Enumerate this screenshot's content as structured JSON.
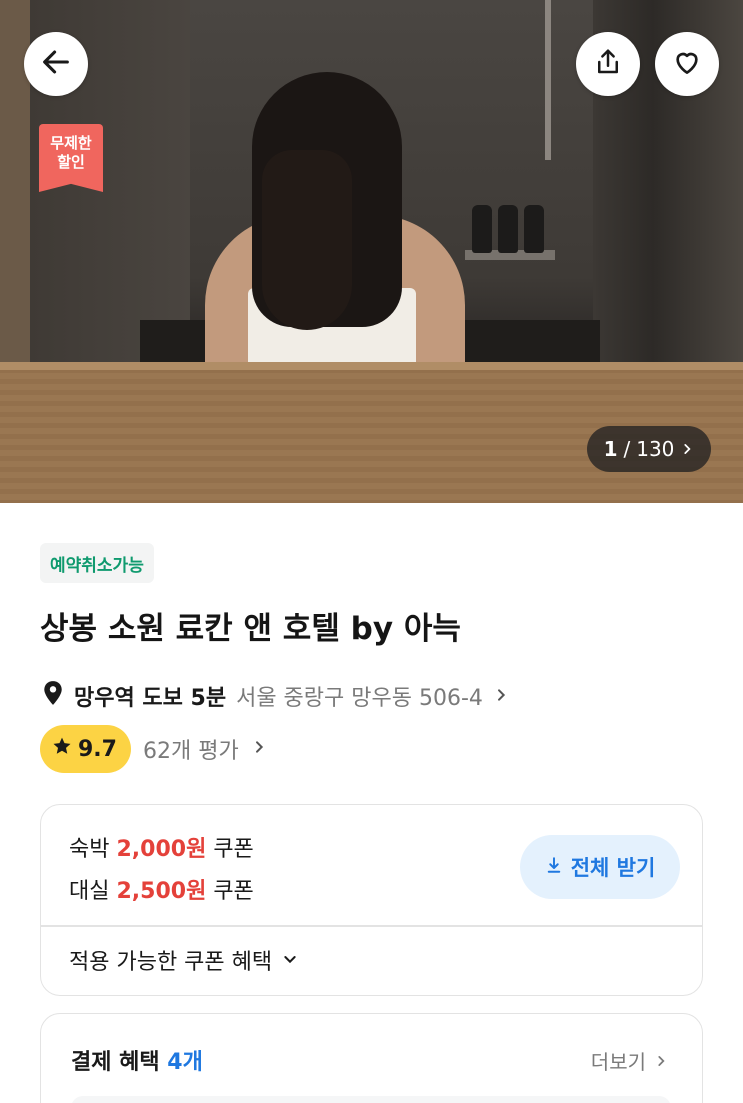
{
  "hero": {
    "discount_badge": "무제한\n할인",
    "photo_counter": {
      "current": "1",
      "separator": "/",
      "total": "130"
    }
  },
  "icons": {
    "back": "back-arrow-icon",
    "share": "share-icon",
    "favorite": "heart-icon"
  },
  "info": {
    "cancel_tag": "예약취소가능",
    "title": "상봉 소원 료칸 앤 호텔 by 아늑",
    "location": {
      "station": "망우역 도보 5분",
      "address": "서울 중랑구 망우동 506-4"
    },
    "rating": {
      "score": "9.7",
      "reviews": "62개 평가"
    }
  },
  "coupons": {
    "lines": [
      {
        "prefix": "숙박",
        "amount": "2,000원",
        "suffix": "쿠폰"
      },
      {
        "prefix": "대실",
        "amount": "2,500원",
        "suffix": "쿠폰"
      }
    ],
    "download_all": "전체 받기",
    "expand_label": "적용 가능한 쿠폰 혜택"
  },
  "payment": {
    "title": "결제 혜택",
    "count": "4개",
    "more": "더보기"
  },
  "colors": {
    "discount_badge": "#f0665e",
    "cancel_tag_text": "#0f9a6e",
    "rating_pill": "#fcd344",
    "coupon_amount": "#e4413a",
    "accent_blue": "#1f78e0",
    "download_button_bg": "#e4f1fd"
  }
}
